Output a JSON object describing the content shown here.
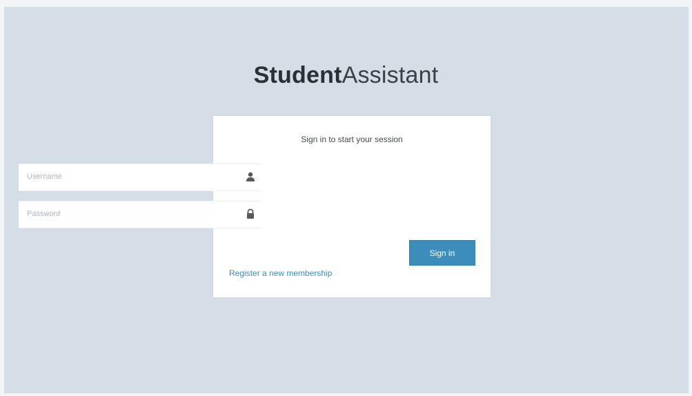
{
  "app": {
    "logo_bold": "Student",
    "logo_light": "Assistant"
  },
  "login": {
    "message": "Sign in to start your session",
    "username_placeholder": "Username",
    "username_value": "",
    "password_placeholder": "Password",
    "password_value": "",
    "signin_label": "Sign in",
    "register_label": "Register a new membership"
  },
  "icons": {
    "username": "user-icon",
    "password": "lock-icon"
  },
  "colors": {
    "accent": "#3c8dbc",
    "background": "#d5dde6",
    "text": "#2b3035"
  }
}
